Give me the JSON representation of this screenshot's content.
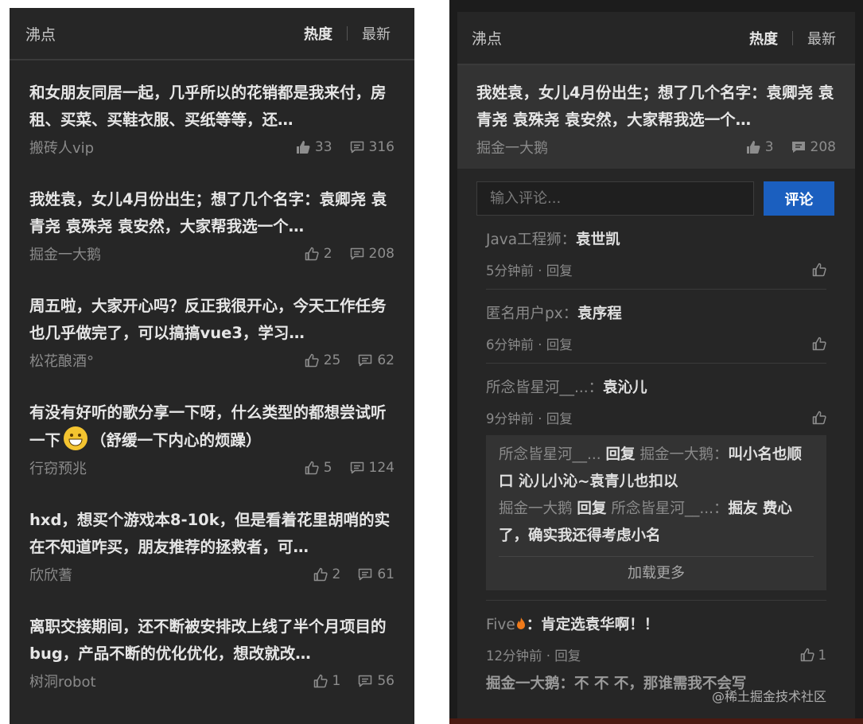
{
  "left": {
    "title": "沸点",
    "tabs": [
      "热度",
      "最新"
    ],
    "posts": [
      {
        "text": "和女朋友同居一起，几乎所以的花销都是我来付，房租、买菜、买鞋衣服、买纸等等，还…",
        "author": "搬砖人vip",
        "likes": "33",
        "comments": "316"
      },
      {
        "text": "我姓袁，女儿4月份出生；想了几个名字：袁卿尧 袁青尧 袁殊尧 袁安然，大家帮我选一个…",
        "author": "掘金一大鹅",
        "likes": "2",
        "comments": "208"
      },
      {
        "text": "周五啦，大家开心吗？反正我很开心，今天工作任务也几乎做完了，可以搞搞vue3，学习…",
        "author": "松花酿酒°",
        "likes": "25",
        "comments": "62"
      },
      {
        "text_a": "有没有好听的歌分享一下呀，什么类型的都想尝试听一下",
        "text_b": "（舒缓一下内心的烦躁）",
        "author": "行窃预兆",
        "likes": "5",
        "comments": "124"
      },
      {
        "text": "hxd，想买个游戏本8-10k，但是看着花里胡哨的实在不知道咋买，朋友推荐的拯救者，可…",
        "author": "欣欣蓍",
        "likes": "2",
        "comments": "61"
      },
      {
        "text": "离职交接期间，还不断被安排改上线了半个月项目的bug，产品不断的优化优化，想改就改…",
        "author": "树洞robot",
        "likes": "1",
        "comments": "56"
      }
    ]
  },
  "right": {
    "title": "沸点",
    "tabs": [
      "热度",
      "最新"
    ],
    "featured": {
      "text": "我姓袁，女儿4月份出生；想了几个名字：袁卿尧 袁青尧 袁殊尧 袁安然，大家帮我选一个…",
      "author": "掘金一大鹅",
      "likes": "3",
      "comments": "208"
    },
    "comment_placeholder": "输入评论...",
    "comment_button": "评论",
    "comments": [
      {
        "user": "Java工程狮：",
        "text": "袁世凯",
        "time": "5分钟前 · 回复"
      },
      {
        "user": "匿名用户px：",
        "text": "袁序程",
        "time": "6分钟前 · 回复"
      },
      {
        "user": "所念皆星河__...：",
        "text": "袁沁儿",
        "time": "9分钟前 · 回复"
      }
    ],
    "replies": [
      {
        "from": "所念皆星河__...",
        "verb": "回复",
        "to": "掘金一大鹅：",
        "text": "叫小名也顺口 沁儿小沁~袁青儿也扣以"
      },
      {
        "from": "掘金一大鹅",
        "verb": "回复",
        "to": "所念皆星河__...：",
        "text": "掘友 费心了，确实我还得考虑小名"
      }
    ],
    "load_more": "加载更多",
    "comment4": {
      "user": "Five",
      "text": "：肯定选袁华啊！！",
      "time": "12分钟前 · 回复",
      "likes": "1"
    },
    "comment5_partial": "掘金一大鹅：不 不 不，那谁需我不会写"
  },
  "watermark": "@稀土掘金技术社区",
  "colors": {
    "accent": "#1b5fbf",
    "panel": "#262626",
    "featured_bg": "#333333"
  }
}
